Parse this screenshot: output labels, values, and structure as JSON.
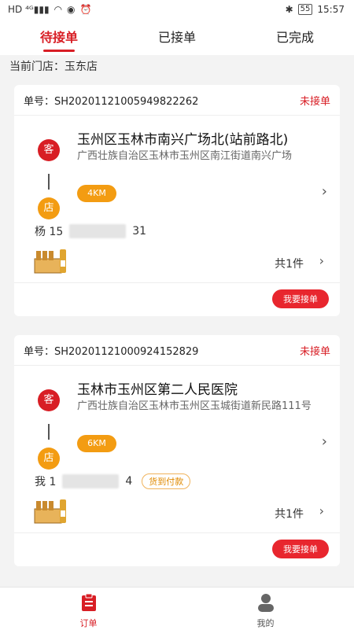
{
  "status_bar": {
    "time": "15:57",
    "battery": "55"
  },
  "tabs": [
    {
      "label": "待接单",
      "active": true
    },
    {
      "label": "已接单",
      "active": false
    },
    {
      "label": "已完成",
      "active": false
    }
  ],
  "store_line": "当前门店：玉东店",
  "orders": [
    {
      "order_label": "单号：SH20201121005949822262",
      "status": "未接单",
      "customer_badge": "客",
      "store_badge": "店",
      "destination": "玉州区玉林市南兴广场北(站前路北)",
      "address": "广西壮族自治区玉林市玉州区南江街道南兴广场",
      "distance": "4KM",
      "buyer_name": "杨 15",
      "buyer_tail": "31",
      "cod_label": "",
      "item_count": "共1件",
      "accept_label": "我要接单"
    },
    {
      "order_label": "单号：SH20201121000924152829",
      "status": "未接单",
      "customer_badge": "客",
      "store_badge": "店",
      "destination": "玉林市玉州区第二人民医院",
      "address": "广西壮族自治区玉林市玉州区玉城街道新民路111号",
      "distance": "6KM",
      "buyer_name": "我 1",
      "buyer_tail": "4",
      "cod_label": "货到付款",
      "item_count": "共1件",
      "accept_label": "我要接单"
    }
  ],
  "bottom_nav": [
    {
      "label": "订单",
      "active": true,
      "icon": "clipboard-icon"
    },
    {
      "label": "我的",
      "active": false,
      "icon": "person-icon"
    }
  ],
  "colors": {
    "accent": "#d81e25",
    "distance": "#f39c12"
  }
}
